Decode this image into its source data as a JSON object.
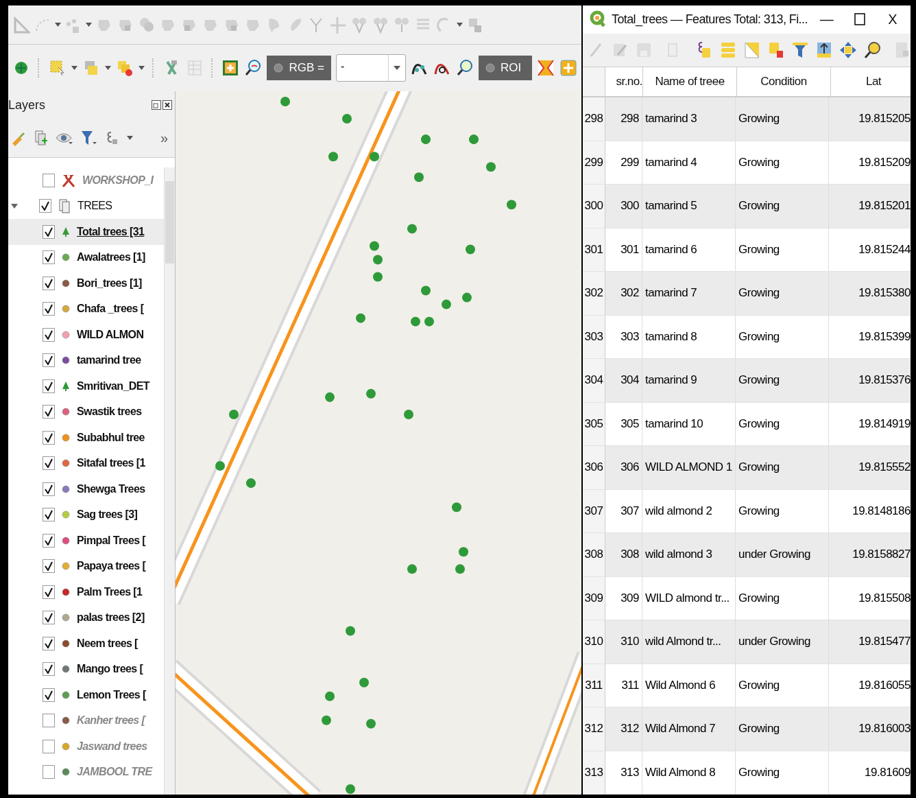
{
  "main_toolbar": {
    "band_label": "RGB =",
    "band_value": "-",
    "roi_label": "ROI"
  },
  "layers_panel": {
    "title": "Layers",
    "overflow": "»",
    "items": [
      {
        "label": "WORKSHOP_I",
        "kind": "workshop",
        "checked": false
      },
      {
        "label": "TREES",
        "kind": "group",
        "checked": true,
        "expanded": true,
        "children": [
          {
            "label": "Total trees [31",
            "kind": "tree",
            "checked": true,
            "selected": true,
            "color": "#3a9a3a"
          },
          {
            "label": "Awalatrees [1]",
            "kind": "dot",
            "checked": true,
            "selected": false,
            "color": "#6aa84f"
          },
          {
            "label": "Bori_trees [1]",
            "kind": "dot",
            "checked": true,
            "selected": false,
            "color": "#8b5a44"
          },
          {
            "label": "Chafa _trees [",
            "kind": "dot",
            "checked": true,
            "selected": false,
            "color": "#d4a93a"
          },
          {
            "label": "WILD ALMON",
            "kind": "dot",
            "checked": true,
            "selected": false,
            "color": "#f2a0b0"
          },
          {
            "label": "tamarind tree",
            "kind": "dot",
            "checked": true,
            "selected": false,
            "color": "#7b4fa0"
          },
          {
            "label": "Smritivan_DET",
            "kind": "tree",
            "checked": true,
            "selected": false,
            "color": "#2e9a3a"
          },
          {
            "label": "Swastik  trees",
            "kind": "dot",
            "checked": true,
            "selected": false,
            "color": "#e0607e"
          },
          {
            "label": "Subabhul tree",
            "kind": "dot",
            "checked": true,
            "selected": false,
            "color": "#f0901a"
          },
          {
            "label": "Sitafal trees [1",
            "kind": "dot",
            "checked": true,
            "selected": false,
            "color": "#e0683c"
          },
          {
            "label": "Shewga Trees",
            "kind": "dot",
            "checked": true,
            "selected": false,
            "color": "#8a78c0"
          },
          {
            "label": "Sag  trees [3]",
            "kind": "dot",
            "checked": true,
            "selected": false,
            "color": "#b8cc40"
          },
          {
            "label": "Pimpal Trees [",
            "kind": "dot",
            "checked": true,
            "selected": false,
            "color": "#e04c80"
          },
          {
            "label": "Papaya trees [",
            "kind": "dot",
            "checked": true,
            "selected": false,
            "color": "#e6ad2e"
          },
          {
            "label": "Palm  Trees [1",
            "kind": "dot",
            "checked": true,
            "selected": false,
            "color": "#c62828"
          },
          {
            "label": "palas trees [2]",
            "kind": "dot",
            "checked": true,
            "selected": false,
            "color": "#b0a890"
          },
          {
            "label": "Neem  trees [",
            "kind": "dot",
            "checked": true,
            "selected": false,
            "color": "#8b4a2a"
          },
          {
            "label": "Mango trees [",
            "kind": "dot",
            "checked": true,
            "selected": false,
            "color": "#707878"
          },
          {
            "label": "Lemon Trees [",
            "kind": "dot",
            "checked": true,
            "selected": false,
            "color": "#5aa050"
          },
          {
            "label": "Kanher trees [",
            "kind": "dot",
            "checked": false,
            "selected": false,
            "color": "#8a5a4a"
          },
          {
            "label": "Jaswand trees",
            "kind": "dot",
            "checked": false,
            "selected": false,
            "color": "#d8a820"
          },
          {
            "label": "JAMBOOL TRE",
            "kind": "dot",
            "checked": false,
            "selected": false,
            "color": "#5a8a5a"
          }
        ]
      }
    ]
  },
  "attribute_table": {
    "title": "Total_trees — Features Total: 313, Fi...",
    "window_buttons": [
      "—",
      "X"
    ],
    "columns": [
      "sr.no.",
      "Name of treee",
      "Condition",
      "Lat"
    ],
    "rows": [
      {
        "row": "298",
        "cells": [
          "298",
          "tamarind 3",
          "Growing",
          "19.815205"
        ]
      },
      {
        "row": "299",
        "cells": [
          "299",
          "tamarind 4",
          "Growing",
          "19.815209"
        ]
      },
      {
        "row": "300",
        "cells": [
          "300",
          "tamarind 5",
          "Growing",
          "19.815201"
        ]
      },
      {
        "row": "301",
        "cells": [
          "301",
          "tamarind 6",
          "Growing",
          "19.815244"
        ]
      },
      {
        "row": "302",
        "cells": [
          "302",
          "tamarind 7",
          "Growing",
          "19.815380"
        ]
      },
      {
        "row": "303",
        "cells": [
          "303",
          "tamarind 8",
          "Growing",
          "19.815399"
        ]
      },
      {
        "row": "304",
        "cells": [
          "304",
          "tamarind 9",
          "Growing",
          "19.815376"
        ]
      },
      {
        "row": "305",
        "cells": [
          "305",
          "tamarind 10",
          "Growing",
          "19.814919"
        ]
      },
      {
        "row": "306",
        "cells": [
          "306",
          "WILD ALMOND 1",
          "Growing",
          "19.815552"
        ]
      },
      {
        "row": "307",
        "cells": [
          "307",
          "wild almond 2",
          "Growing",
          "19.8148186"
        ]
      },
      {
        "row": "308",
        "cells": [
          "308",
          "wild almond 3",
          "under Growing",
          "19.8158827"
        ]
      },
      {
        "row": "309",
        "cells": [
          "309",
          "WILD almond tr...",
          "Growing",
          "19.815508"
        ]
      },
      {
        "row": "310",
        "cells": [
          "310",
          "wild Almond tr...",
          "under Growing",
          "19.815477"
        ]
      },
      {
        "row": "311",
        "cells": [
          "311",
          "Wild Almond 6",
          "Growing",
          "19.816055"
        ]
      },
      {
        "row": "312",
        "cells": [
          "312",
          "Wild Almond 7",
          "Growing",
          "19.816003"
        ]
      },
      {
        "row": "313",
        "cells": [
          "313",
          "Wild Almond 8",
          "Growing",
          "19.81609"
        ]
      }
    ]
  }
}
